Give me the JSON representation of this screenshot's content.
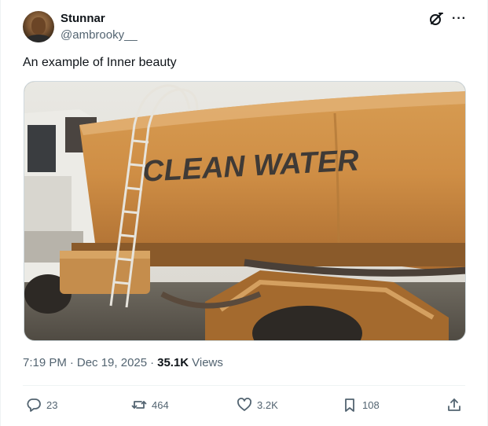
{
  "author": {
    "display_name": "Stunnar",
    "handle": "@ambrooky__"
  },
  "tweet": {
    "text": "An example of Inner beauty",
    "media_text": "CLEAN WATER"
  },
  "meta": {
    "time": "7:19 PM",
    "separator1": "·",
    "date": "Dec 19, 2025",
    "separator2": "·",
    "views_count": "35.1K",
    "views_label": "Views"
  },
  "actions": {
    "replies": "23",
    "reposts": "464",
    "likes": "3.2K",
    "bookmarks": "108"
  },
  "icons": {
    "header": [
      "grok-icon",
      "more-icon"
    ],
    "actions": [
      "reply-icon",
      "repost-icon",
      "like-icon",
      "bookmark-icon",
      "share-icon"
    ]
  },
  "colors": {
    "text_primary": "#0f1419",
    "text_secondary": "#536471",
    "border": "#cfd9de"
  }
}
